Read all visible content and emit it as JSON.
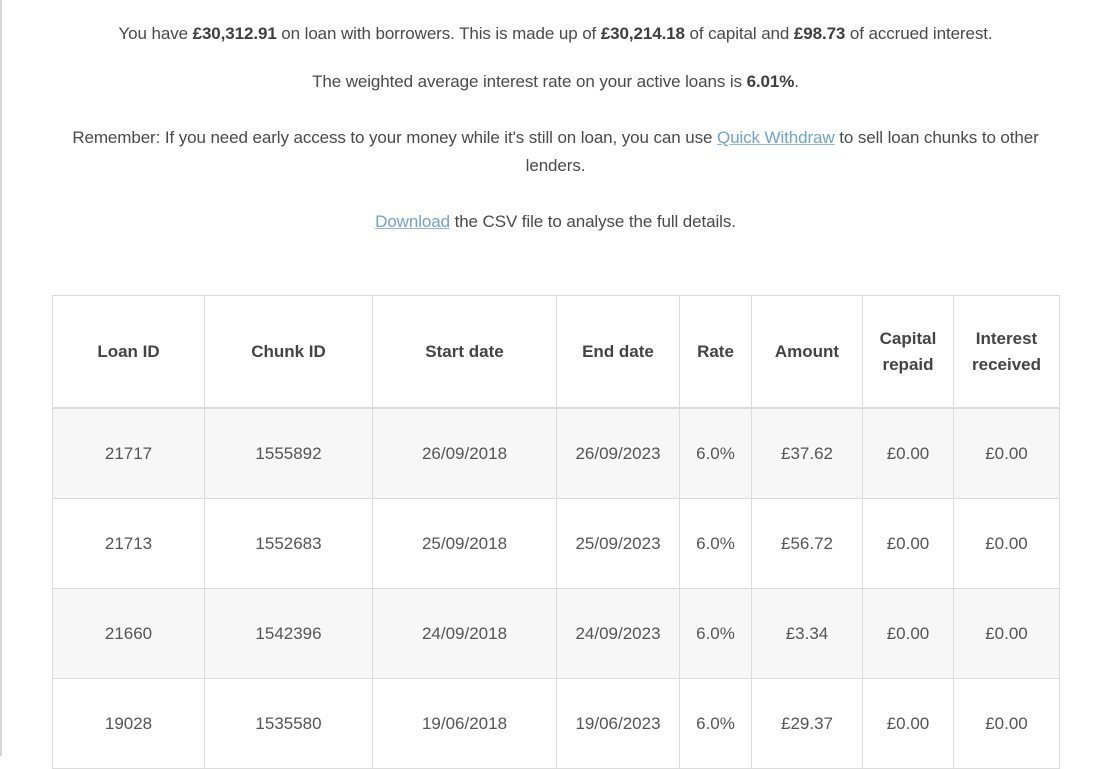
{
  "summary": {
    "line1": {
      "prefix": "You have ",
      "total_on_loan": "£30,312.91",
      "middle1": " on loan with borrowers. This is made up of ",
      "capital": "£30,214.18",
      "middle2": " of capital and ",
      "accrued_interest": "£98.73",
      "suffix": " of accrued interest."
    },
    "line2": {
      "prefix": "The weighted average interest rate on your active loans is ",
      "rate": "6.01%",
      "suffix": "."
    },
    "line3": {
      "prefix": "Remember: If you need early access to your money while it's still on loan, you can use ",
      "link_label": "Quick Withdraw",
      "suffix": " to sell loan chunks to other lenders."
    },
    "line4": {
      "link_label": "Download",
      "suffix": " the CSV file to analyse the full details."
    }
  },
  "colors": {
    "link": "#6fa3cf",
    "text": "#4a4a4a",
    "border": "#dcdcdc",
    "stripe": "#f7f7f7"
  },
  "table": {
    "headers": [
      "Loan ID",
      "Chunk ID",
      "Start date",
      "End date",
      "Rate",
      "Amount",
      "Capital repaid",
      "Interest received"
    ],
    "rows": [
      [
        "21717",
        "1555892",
        "26/09/2018",
        "26/09/2023",
        "6.0%",
        "£37.62",
        "£0.00",
        "£0.00"
      ],
      [
        "21713",
        "1552683",
        "25/09/2018",
        "25/09/2023",
        "6.0%",
        "£56.72",
        "£0.00",
        "£0.00"
      ],
      [
        "21660",
        "1542396",
        "24/09/2018",
        "24/09/2023",
        "6.0%",
        "£3.34",
        "£0.00",
        "£0.00"
      ],
      [
        "19028",
        "1535580",
        "19/06/2018",
        "19/06/2023",
        "6.0%",
        "£29.37",
        "£0.00",
        "£0.00"
      ]
    ]
  }
}
